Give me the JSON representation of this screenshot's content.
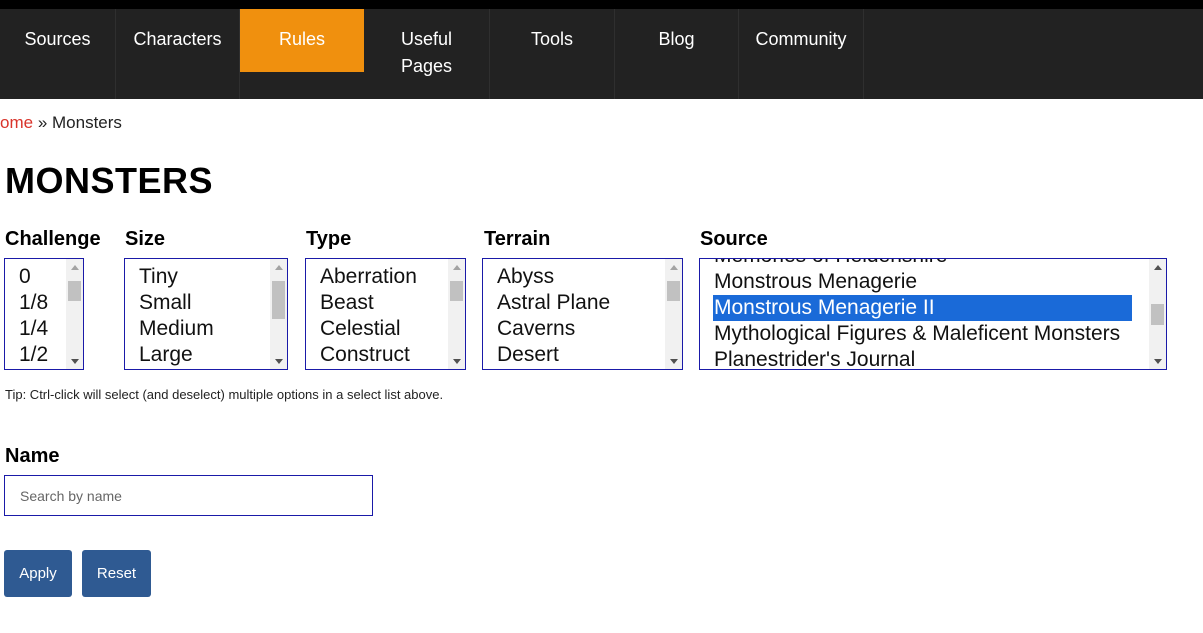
{
  "nav": {
    "items": [
      {
        "label": "Sources"
      },
      {
        "label": "Characters"
      },
      {
        "label": "Rules",
        "active": true
      },
      {
        "label": "Useful Pages"
      },
      {
        "label": "Tools"
      },
      {
        "label": "Blog"
      },
      {
        "label": "Community"
      }
    ],
    "active_color": "#f0900e",
    "background_color": "#222222"
  },
  "breadcrumb": {
    "home_text": "ome",
    "separator": "»",
    "current": "Monsters"
  },
  "page_title": "MONSTERS",
  "filters": {
    "challenge": {
      "label": "Challenge",
      "options": [
        "0",
        "1/8",
        "1/4",
        "1/2"
      ]
    },
    "size": {
      "label": "Size",
      "options": [
        "Tiny",
        "Small",
        "Medium",
        "Large"
      ]
    },
    "type": {
      "label": "Type",
      "options": [
        "Aberration",
        "Beast",
        "Celestial",
        "Construct"
      ]
    },
    "terrain": {
      "label": "Terrain",
      "options": [
        "Abyss",
        "Astral Plane",
        "Caverns",
        "Desert"
      ]
    },
    "source": {
      "label": "Source",
      "options": [
        "Memories of Heldenshire",
        "Monstrous Menagerie",
        "Monstrous Menagerie II",
        "Mythological Figures & Maleficent Monsters",
        "Planestrider's Journal"
      ],
      "selected": "Monstrous Menagerie II",
      "selected_color": "#1a6ad8"
    }
  },
  "tip": "Tip: Ctrl-click will select (and deselect) multiple options in a select list above.",
  "name_filter": {
    "label": "Name",
    "placeholder": "Search by name",
    "value": ""
  },
  "buttons": {
    "apply": "Apply",
    "reset": "Reset",
    "color": "#2f5a92"
  }
}
